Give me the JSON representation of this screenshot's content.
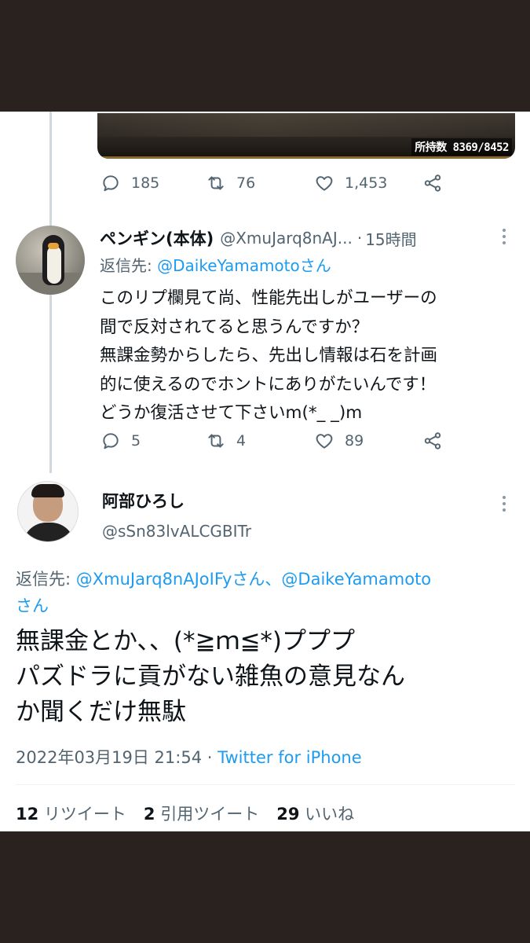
{
  "first_tweet": {
    "image_overlay_text": "所持数 8369/8452",
    "actions": {
      "replies": "185",
      "retweets": "76",
      "likes": "1,453"
    }
  },
  "reply_tweet": {
    "display_name": "ペンギン(本体)",
    "handle": "@XmuJarq8nAJ...",
    "separator": "·",
    "time": "15時間",
    "reply_to_label": "返信先:",
    "reply_to_mention": "@DaikeYamamotoさん",
    "body_lines": [
      "このリプ欄見て尚、性能先出しがユーザーの",
      "間で反対されてると思うんですか？",
      "無課金勢からしたら、先出し情報は石を計画",
      "的に使えるのでホントにありがたいんです！",
      "どうか復活させて下さいm(*_ _)m"
    ],
    "actions": {
      "replies": "5",
      "retweets": "4",
      "likes": "89"
    }
  },
  "main_tweet": {
    "display_name": "阿部ひろし",
    "handle": "@sSn83lvALCGBITr",
    "reply_to_label": "返信先:",
    "reply_to_mentions_line1": "@XmuJarq8nAJoIFyさん、@DaikeYamamoto",
    "reply_to_mentions_line2": "さん",
    "body_lines": [
      "無課金とか、、(*≧ｍ≦*)プププ",
      "パズドラに貢がない雑魚の意見なん",
      "か聞くだけ無駄"
    ],
    "timestamp": "2022年03月19日 21:54",
    "separator": "·",
    "source": "Twitter for iPhone",
    "stats": {
      "retweets_count": "12",
      "retweets_label": "リツイート",
      "quotes_count": "2",
      "quotes_label": "引用ツイート",
      "likes_count": "29",
      "likes_label": "いいね"
    }
  },
  "colors": {
    "frame": "#2a221f",
    "text_primary": "#0f1419",
    "text_secondary": "#536471",
    "link": "#1d9bf0"
  },
  "icons": [
    "reply-icon",
    "retweet-icon",
    "like-icon",
    "share-icon",
    "more-icon"
  ]
}
